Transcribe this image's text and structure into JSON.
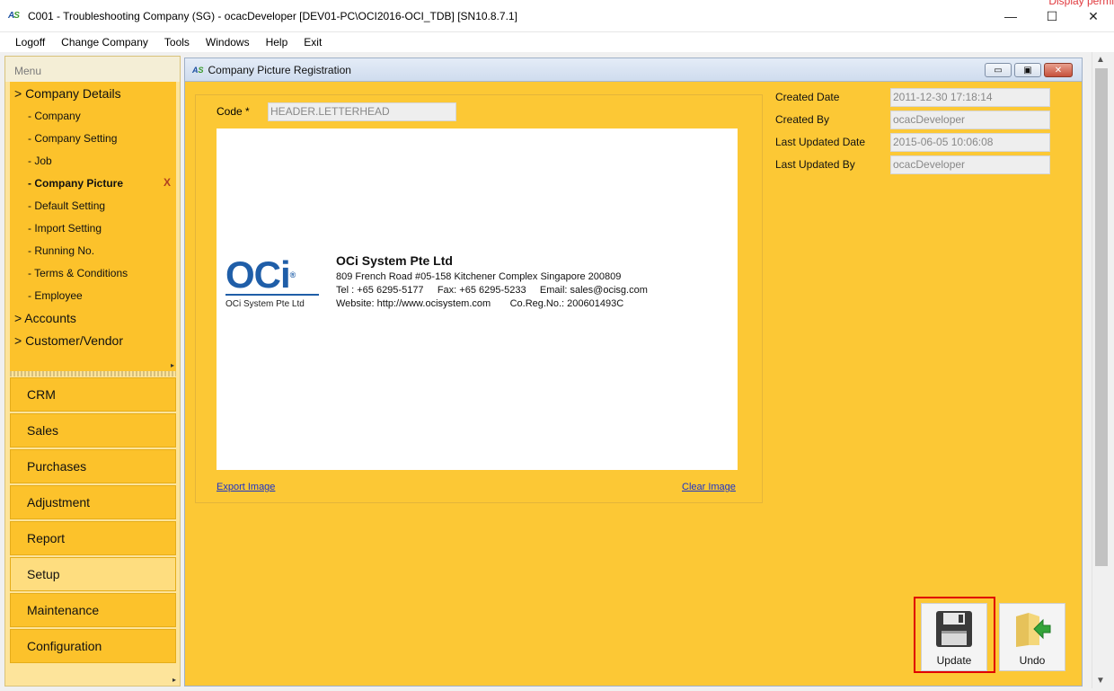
{
  "window": {
    "app_icon": "AS",
    "title": "C001 - Troubleshooting Company (SG) - ocacDeveloper [DEV01-PC\\OCI2016-OCI_TDB] [SN10.8.7.1]",
    "minimize": "—",
    "maximize": "☐",
    "close": "✕",
    "ghost_text": "Display permi"
  },
  "menubar": [
    "Logoff",
    "Change Company",
    "Tools",
    "Windows",
    "Help",
    "Exit"
  ],
  "sidebar": {
    "header": "Menu",
    "tree": [
      {
        "kind": "node",
        "label": "> Company Details"
      },
      {
        "kind": "leaf",
        "label": "- Company"
      },
      {
        "kind": "leaf",
        "label": "- Company Setting"
      },
      {
        "kind": "leaf",
        "label": "- Job"
      },
      {
        "kind": "leaf",
        "label": "- Company Picture",
        "active": true,
        "close_mark": "X"
      },
      {
        "kind": "leaf",
        "label": "- Default Setting"
      },
      {
        "kind": "leaf",
        "label": "- Import Setting"
      },
      {
        "kind": "leaf",
        "label": "- Running No."
      },
      {
        "kind": "leaf",
        "label": "- Terms & Conditions"
      },
      {
        "kind": "leaf",
        "label": "- Employee"
      },
      {
        "kind": "node",
        "label": "> Accounts"
      },
      {
        "kind": "node",
        "label": "> Customer/Vendor"
      }
    ],
    "modules": [
      "CRM",
      "Sales",
      "Purchases",
      "Adjustment",
      "Report",
      "Setup",
      "Maintenance",
      "Configuration"
    ],
    "selected_module": "Setup"
  },
  "form": {
    "title": "Company Picture Registration",
    "code_label": "Code *",
    "code_value": "HEADER.LETTERHEAD",
    "letterhead": {
      "logo_text": "OCi",
      "logo_reg": "®",
      "logo_sub": "OCi System Pte Ltd",
      "company": "OCi System Pte Ltd",
      "address": "809 French Road #05-158 Kitchener Complex Singapore 200809",
      "contact": "Tel : +65 6295-5177     Fax: +65 6295-5233     Email: sales@ocisg.com",
      "web": "Website: http://www.ocisystem.com       Co.Reg.No.: 200601493C"
    },
    "export_link": "Export Image",
    "clear_link": "Clear Image",
    "created_date_label": "Created Date",
    "created_date": "2011-12-30 17:18:14",
    "created_by_label": "Created By",
    "created_by": "ocacDeveloper",
    "updated_date_label": "Last Updated Date",
    "updated_date": "2015-06-05 10:06:08",
    "updated_by_label": "Last Updated By",
    "updated_by": "ocacDeveloper",
    "update_button": "Update",
    "undo_button": "Undo"
  }
}
